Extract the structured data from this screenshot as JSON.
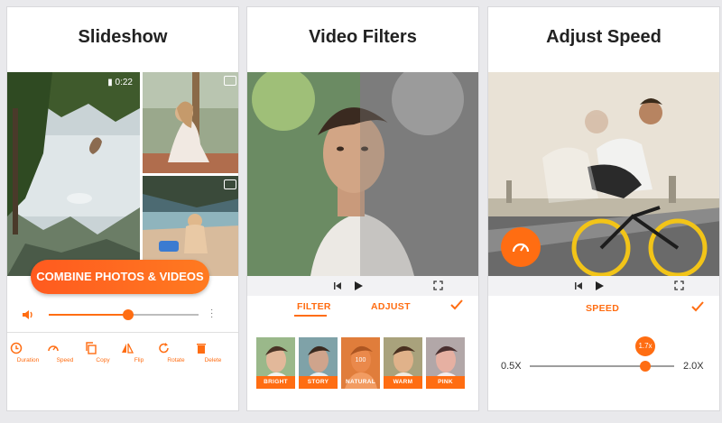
{
  "slideshow": {
    "title": "Slideshow",
    "duration_badge": "0:22",
    "combine_button": "COMBINE PHOTOS & VIDEOS",
    "volume_level": 0.53,
    "tools": [
      {
        "label": "Duration",
        "icon": "clock-icon"
      },
      {
        "label": "Speed",
        "icon": "speedometer-icon"
      },
      {
        "label": "Copy",
        "icon": "copy-icon"
      },
      {
        "label": "Flip",
        "icon": "flip-icon"
      },
      {
        "label": "Rotate",
        "icon": "rotate-icon"
      },
      {
        "label": "Delete",
        "icon": "trash-icon"
      }
    ]
  },
  "filters": {
    "title": "Video Filters",
    "tabs": {
      "filter": "FILTER",
      "adjust": "ADJUST"
    },
    "selected_tab": "FILTER",
    "thumbnails": [
      {
        "label": "BRIGHT"
      },
      {
        "label": "STORY"
      },
      {
        "label": "NATURAL",
        "value": "100",
        "selected": true
      },
      {
        "label": "WARM"
      },
      {
        "label": "PINK"
      }
    ]
  },
  "speed": {
    "title": "Adjust Speed",
    "tab": "SPEED",
    "min_label": "0.5X",
    "max_label": "2.0X",
    "value_label": "1.7x",
    "slider_fraction": 0.8
  },
  "colors": {
    "accent": "#ff6d12",
    "text": "#222222",
    "background": "#e9e9ec"
  }
}
